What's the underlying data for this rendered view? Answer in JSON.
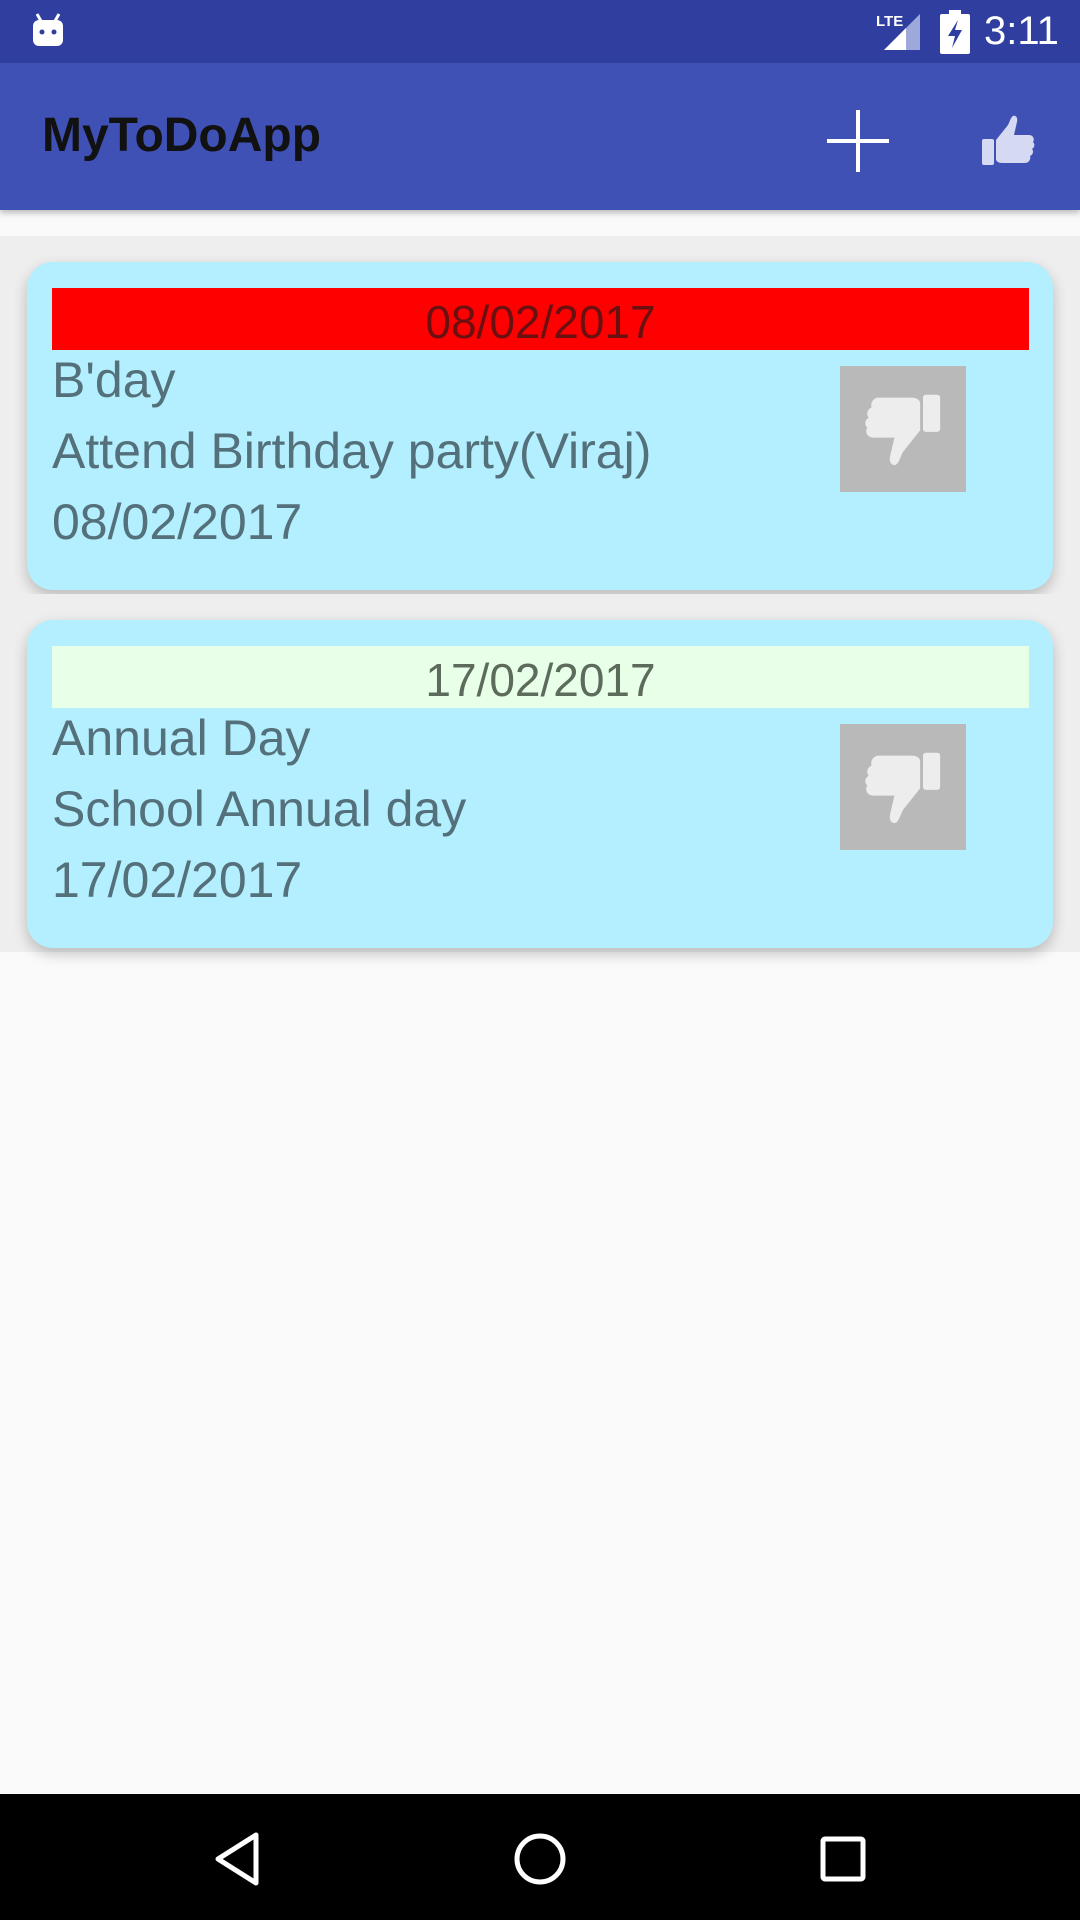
{
  "status_bar": {
    "network_label": "LTE",
    "time": "3:11",
    "background_color": "#303f9f"
  },
  "app_bar": {
    "title": "MyToDoApp",
    "background_color": "#3f51b5",
    "actions": [
      {
        "icon": "plus-icon"
      },
      {
        "icon": "thumbs-up-icon"
      }
    ]
  },
  "tasks": [
    {
      "banner_date": "08/02/2017",
      "banner_color": "#ff0000",
      "title": "B'day",
      "description": "Attend Birthday party(Viraj)",
      "date": "08/02/2017",
      "action_icon": "thumbs-down-icon"
    },
    {
      "banner_date": "17/02/2017",
      "banner_color": "#e8ffe8",
      "title": "Annual Day",
      "description": "School Annual day",
      "date": "17/02/2017",
      "action_icon": "thumbs-down-icon"
    }
  ],
  "card_color": "#b3efff",
  "nav_bar": {
    "buttons": [
      {
        "icon": "back-icon"
      },
      {
        "icon": "home-icon"
      },
      {
        "icon": "recents-icon"
      }
    ]
  }
}
